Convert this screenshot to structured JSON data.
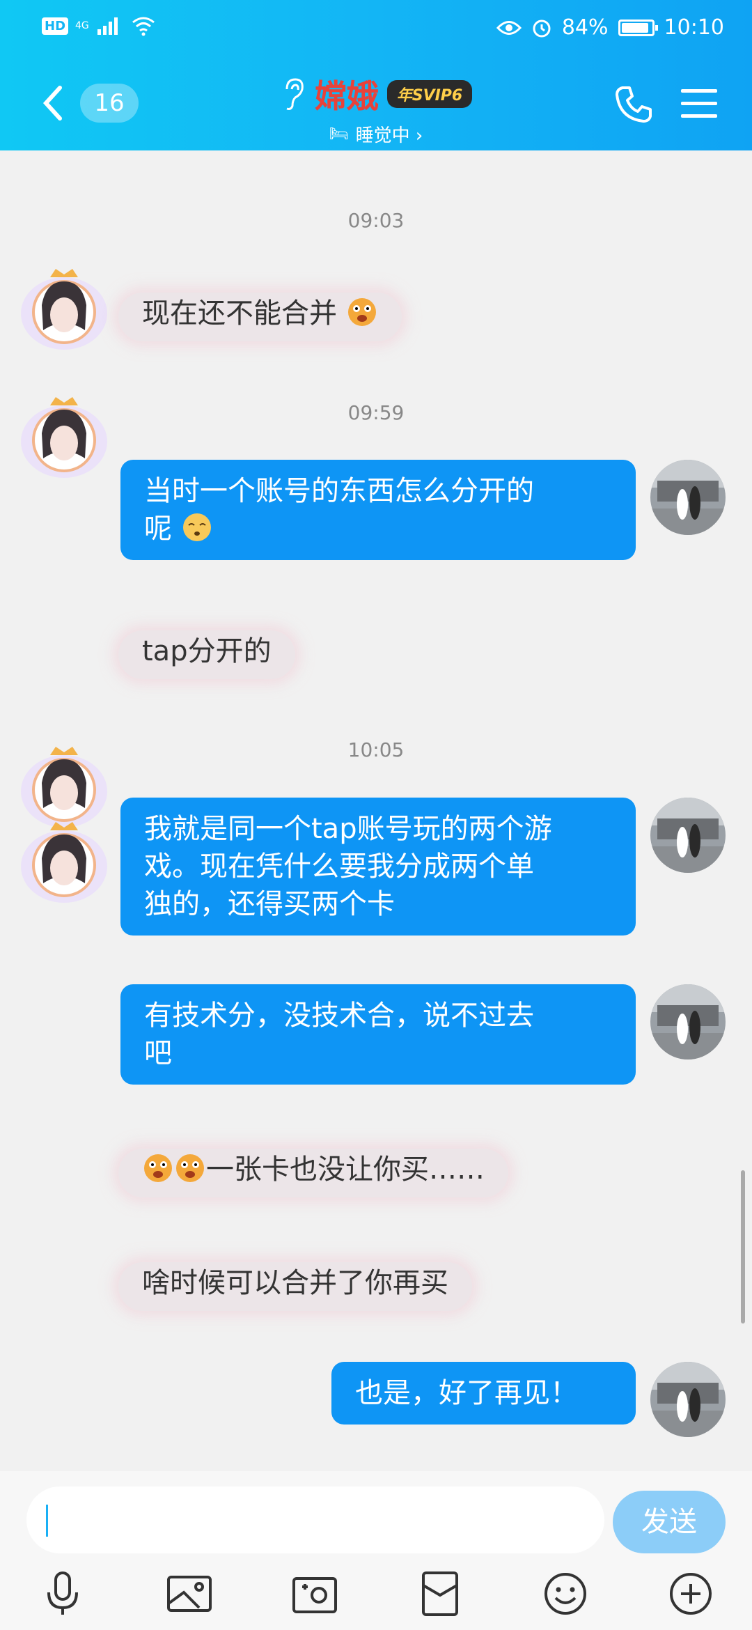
{
  "status_bar": {
    "hd": "HD",
    "network": "4G",
    "battery": "84%",
    "time": "10:10"
  },
  "header": {
    "unread_count": "16",
    "contact_name": "嫦娥",
    "vip_badge": "年SVIP6",
    "status": "睡觉中 ›"
  },
  "timestamps": [
    "09:03",
    "09:59",
    "10:05"
  ],
  "messages": [
    {
      "text": "现在还不能合并"
    },
    {
      "line1": "当时一个账号的东西怎么分开的",
      "line2": "呢"
    },
    {
      "text": "tap分开的"
    },
    {
      "line1": "我就是同一个tap账号玩的两个游",
      "line2": "戏。现在凭什么要我分成两个单",
      "line3": "独的，还得买两个卡"
    },
    {
      "line1": "有技术分，没技术合，说不过去",
      "line2": "吧"
    },
    {
      "text": "一张卡也没让你买……"
    },
    {
      "text": "啥时候可以合并了你再买"
    },
    {
      "text": "也是，好了再见！"
    }
  ],
  "input": {
    "placeholder": "",
    "send_label": "发送"
  },
  "colors": {
    "header": "#13b5f5",
    "my_bubble": "#0e95f5",
    "their_bubble": "#ece5e8",
    "name": "#e8423a"
  },
  "icons": [
    "back-icon",
    "ear-icon",
    "phone-icon",
    "menu-icon",
    "mic-icon",
    "image-icon",
    "camera-icon",
    "red-packet-icon",
    "emoji-icon",
    "plus-icon"
  ]
}
